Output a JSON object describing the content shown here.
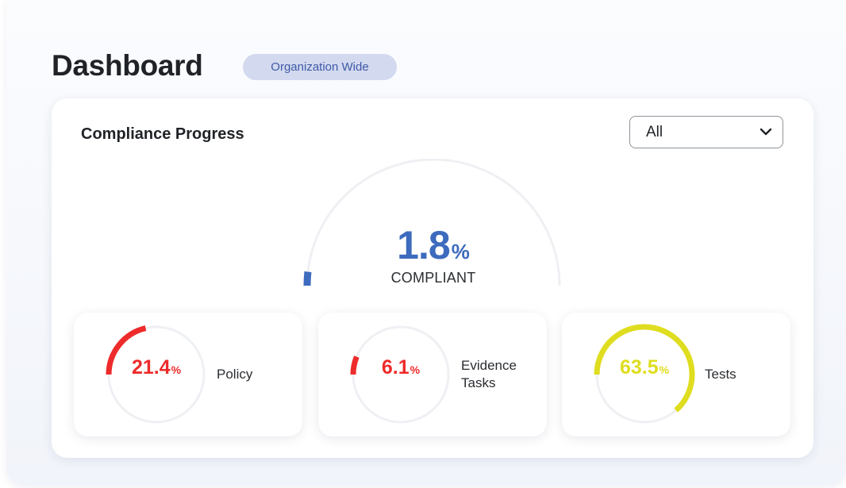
{
  "header": {
    "title": "Dashboard",
    "scope_badge": "Organization Wide"
  },
  "compliance": {
    "title": "Compliance Progress",
    "filter": {
      "selected": "All"
    },
    "overall": {
      "value": "1.8",
      "unit": "%",
      "caption": "COMPLIANT",
      "percent": 1.8,
      "color": "#3d6bbd"
    },
    "stats": [
      {
        "value": "21.4",
        "unit": "%",
        "percent": 21.4,
        "label_lines": [
          "Policy"
        ],
        "color": "#ee2b2b"
      },
      {
        "value": "6.1",
        "unit": "%",
        "percent": 6.1,
        "label_lines": [
          "Evidence",
          "Tasks"
        ],
        "color": "#ee2b2b"
      },
      {
        "value": "63.5",
        "unit": "%",
        "percent": 63.5,
        "label_lines": [
          "Tests"
        ],
        "color": "#dfdd1f"
      }
    ]
  },
  "colors": {
    "track": "#eef0f3",
    "badge_bg": "#d3d9ef",
    "badge_text": "#3f5aa8"
  },
  "icons": {
    "filter_dropdown": "chevron-down-icon"
  }
}
